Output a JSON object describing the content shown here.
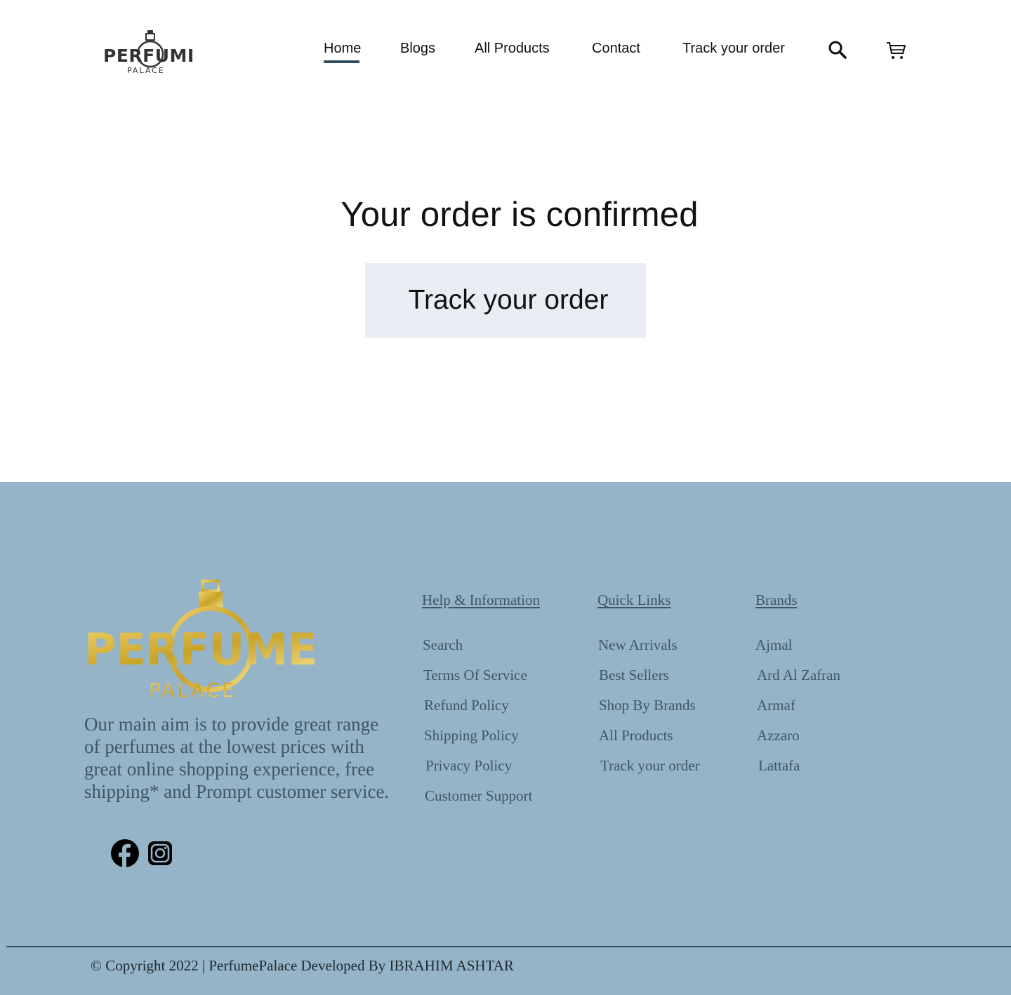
{
  "brand": {
    "name_line1": "PERFUME",
    "name_line2": "PALACE"
  },
  "nav": {
    "items": [
      {
        "label": "Home",
        "active": true
      },
      {
        "label": "Blogs"
      },
      {
        "label": "All Products"
      },
      {
        "label": "Contact"
      },
      {
        "label": "Track your order"
      }
    ],
    "search_icon": "search-icon",
    "cart_icon": "cart-icon"
  },
  "main": {
    "title": "Your order is confirmed",
    "track_button": "Track your order"
  },
  "footer": {
    "about": "Our main aim is to provide great range of perfumes at the lowest prices with great online shopping experience, free shipping* and Prompt customer service.",
    "socials": [
      "facebook-icon",
      "instagram-icon"
    ],
    "columns": [
      {
        "heading": "Help & Information",
        "links": [
          "Search",
          "Terms Of Service",
          "Refund Policy",
          "Shipping Policy",
          "Privacy Policy",
          "Customer Support"
        ]
      },
      {
        "heading": "Quick Links",
        "links": [
          "New Arrivals",
          "Best Sellers",
          "Shop By Brands",
          "All Products",
          "Track your order"
        ]
      },
      {
        "heading": "Brands",
        "links": [
          "Ajmal",
          "Ard Al Zafran",
          "Armaf",
          "Azzaro",
          "Lattafa"
        ]
      }
    ],
    "copyright": "© Copyright 2022 | PerfumePalace Developed By IBRAHIM ASHTAR"
  },
  "colors": {
    "footer_bg": "#95b4c7",
    "footer_text": "#3f5763",
    "button_bg": "#e8eef3",
    "nav_underline": "#2f4b5c",
    "gold": "#c9a227"
  }
}
